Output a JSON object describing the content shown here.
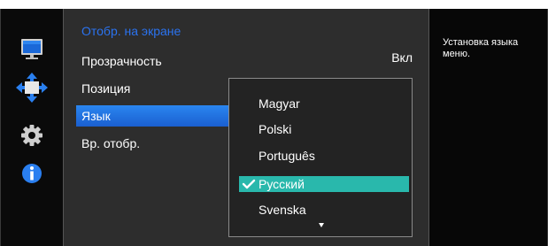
{
  "icons": [
    "monitor-icon",
    "position-arrows-icon",
    "gear-icon",
    "info-icon"
  ],
  "menu": {
    "title": "Отобр. на экране",
    "items": [
      {
        "label": "Прозрачность",
        "value": "Вкл"
      },
      {
        "label": "Позиция"
      },
      {
        "label": "Язык",
        "selected": true
      },
      {
        "label": "Вр. отобр."
      }
    ]
  },
  "language_dropdown": {
    "options": [
      "Magyar",
      "Polski",
      "Português",
      "Русский",
      "Svenska"
    ],
    "selected": "Русский",
    "more_indicator": "down-arrow"
  },
  "help": {
    "text": "Установка языка меню."
  },
  "colors": {
    "title_blue": "#2b73f0",
    "selected_item_blue": "#1f6fe0",
    "selected_option_teal": "#29b8ac",
    "panel_bg": "#2d2d2d",
    "frame_bg": "#070707"
  }
}
